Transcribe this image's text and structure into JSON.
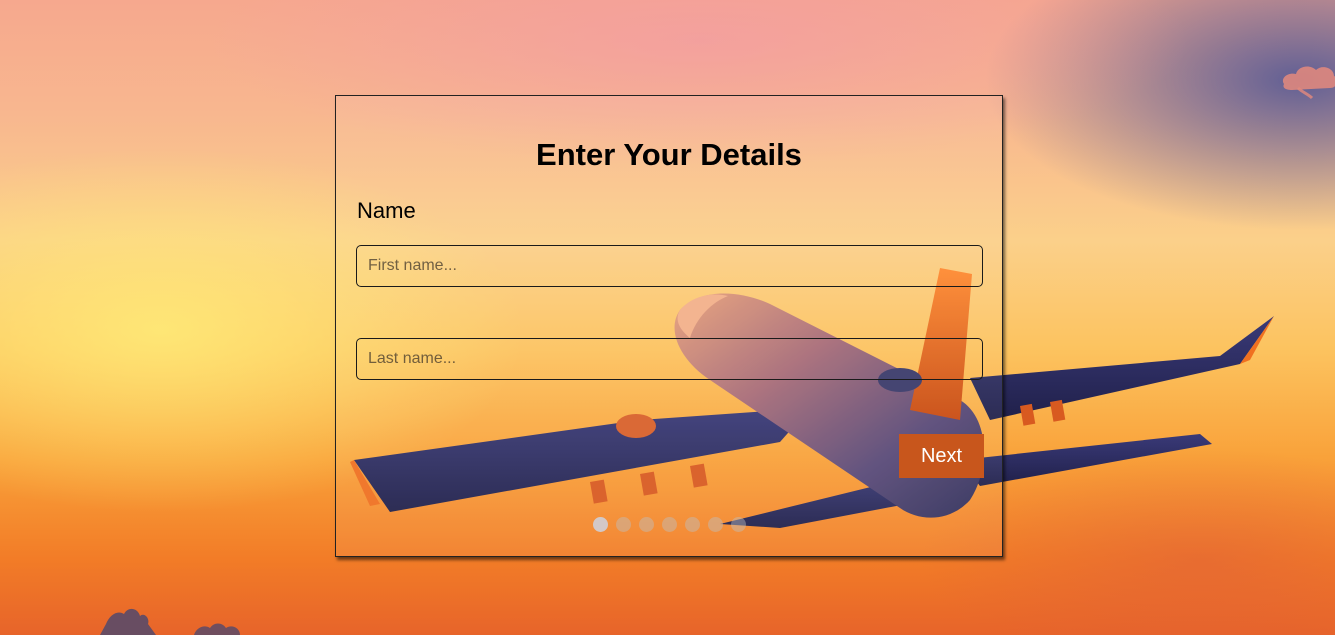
{
  "form": {
    "title": "Enter Your Details",
    "section_label": "Name",
    "first_name": {
      "value": "",
      "placeholder": "First name..."
    },
    "last_name": {
      "value": "",
      "placeholder": "Last name..."
    },
    "next_label": "Next"
  },
  "steps": {
    "total": 7,
    "current": 1
  },
  "colors": {
    "accent": "#c8561c",
    "border": "#1a1a1a",
    "title_text": "#000000"
  },
  "background": {
    "scene": "airplane-sunset-background",
    "icons": [
      "airplane-illustration",
      "cloud-shape"
    ]
  }
}
